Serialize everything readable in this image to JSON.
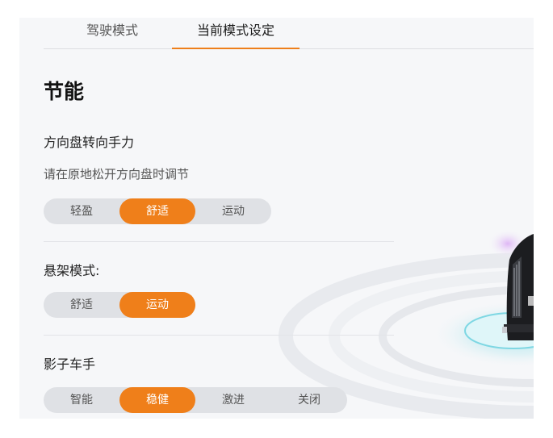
{
  "tabs": [
    {
      "label": "驾驶模式",
      "active": false
    },
    {
      "label": "当前模式设定",
      "active": true
    }
  ],
  "mode_title": "节能",
  "steering": {
    "label": "方向盘转向手力",
    "hint": "请在原地松开方向盘时调节",
    "options": [
      "轻盈",
      "舒适",
      "运动"
    ],
    "selected": "舒适"
  },
  "suspension": {
    "label": "悬架模式:",
    "options": [
      "舒适",
      "运动"
    ],
    "selected": "运动"
  },
  "shadow_driver": {
    "label": "影子车手",
    "options": [
      "智能",
      "稳健",
      "激进",
      "关闭"
    ],
    "selected": "稳健"
  },
  "colors": {
    "accent": "#ef7f1a",
    "segment_bg": "#dfe1e5",
    "panel_bg": "#f6f7f9"
  }
}
